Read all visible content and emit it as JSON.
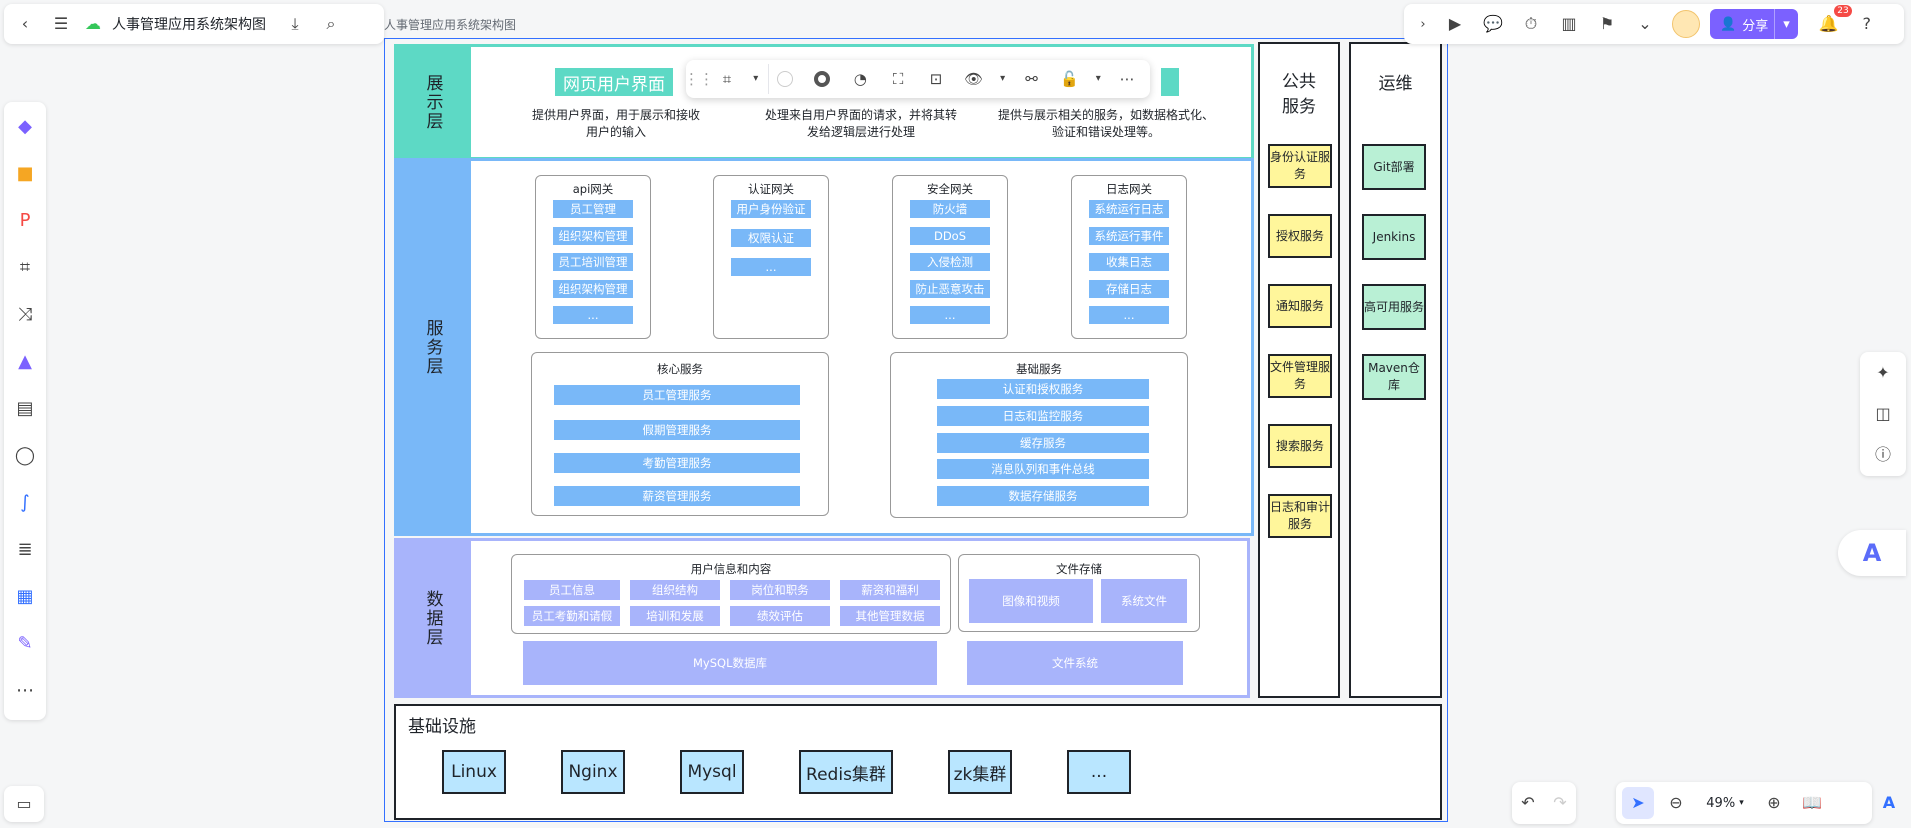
{
  "doc": {
    "title": "人事管理应用系统架构图",
    "breadcrumb": "人事管理应用系统架构图"
  },
  "toolbar": {
    "share_label": "分享",
    "notifications": "23",
    "zoom": "49%"
  },
  "layers": {
    "presentation": {
      "label": "展示层",
      "title": "网页用户界面",
      "descs": [
        "提供用户界面，用于展示和接收用户的输入",
        "处理来自用户界面的请求，并将其转发给逻辑层进行处理",
        "提供与展示相关的服务，如数据格式化、验证和错误处理等。"
      ]
    },
    "service": {
      "label": "服务层",
      "gateways": [
        {
          "title": "api网关",
          "items": [
            "员工管理",
            "组织架构管理",
            "员工培训管理",
            "组织架构管理",
            "..."
          ]
        },
        {
          "title": "认证网关",
          "items": [
            "用户身份验证",
            "权限认证",
            "..."
          ]
        },
        {
          "title": "安全网关",
          "items": [
            "防火墙",
            "DDoS",
            "入侵检测",
            "防止恶意攻击",
            "..."
          ]
        },
        {
          "title": "日志网关",
          "items": [
            "系统运行日志",
            "系统运行事件",
            "收集日志",
            "存储日志",
            "..."
          ]
        }
      ],
      "core": {
        "title": "核心服务",
        "items": [
          "员工管理服务",
          "假期管理服务",
          "考勤管理服务",
          "薪资管理服务"
        ]
      },
      "base": {
        "title": "基础服务",
        "items": [
          "认证和授权服务",
          "日志和监控服务",
          "缓存服务",
          "消息队列和事件总线",
          "数据存储服务"
        ]
      }
    },
    "data": {
      "label": "数据层",
      "user_info": {
        "title": "用户信息和内容",
        "items": [
          "员工信息",
          "组织结构",
          "岗位和职务",
          "薪资和福利",
          "员工考勤和请假",
          "培训和发展",
          "绩效评估",
          "其他管理数据"
        ]
      },
      "file_storage": {
        "title": "文件存储",
        "items": [
          "图像和视频",
          "系统文件"
        ]
      },
      "mysql": "MySQL数据库",
      "filesystem": "文件系统"
    }
  },
  "public_services": {
    "title": "公共服务",
    "items": [
      "身份认证服务",
      "授权服务",
      "通知服务",
      "文件管理服务",
      "搜索服务",
      "日志和审计服务"
    ]
  },
  "ops": {
    "title": "运维",
    "items": [
      "Git部署",
      "Jenkins",
      "高可用服务",
      "Maven仓库"
    ]
  },
  "infra": {
    "title": "基础设施",
    "items": [
      "Linux",
      "Nginx",
      "Mysql",
      "Redis集群",
      "zk集群",
      "..."
    ]
  },
  "colors": {
    "presentation": "#5dd9c5",
    "service": "#79b8f8",
    "data": "#a8b4fb",
    "public": "#fff69b",
    "ops": "#b9f0d5",
    "infra": "#b9e6ff",
    "accent": "#7b61ff"
  }
}
